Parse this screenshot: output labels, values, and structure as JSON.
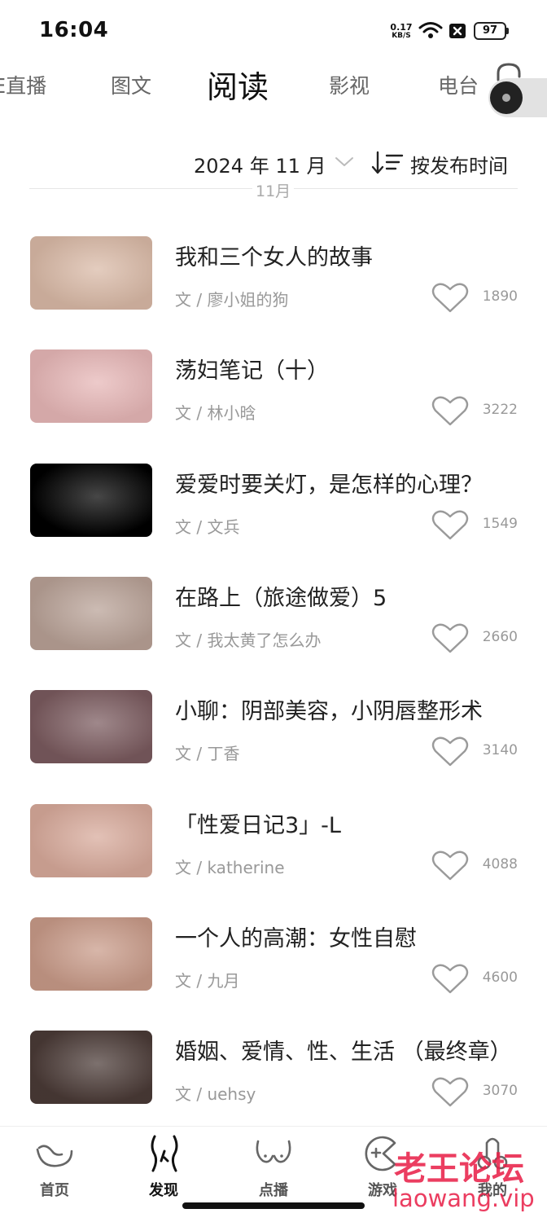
{
  "status_bar": {
    "time": "16:04",
    "net_speed_value": "0.17",
    "net_speed_unit": "KB/S",
    "battery": "97",
    "icons": [
      "wifi-icon",
      "sim-x-icon",
      "battery-icon"
    ]
  },
  "top_tabs": [
    {
      "label": "IE直播",
      "active": false
    },
    {
      "label": "图文",
      "active": false
    },
    {
      "label": "阅读",
      "active": true
    },
    {
      "label": "影视",
      "active": false
    },
    {
      "label": "电台",
      "active": false
    }
  ],
  "filter": {
    "date_label": "2024 年 11 月",
    "sort_label": "按发布时间",
    "month_marker": "11月"
  },
  "articles": [
    {
      "title": "我和三个女人的故事",
      "author": "文 / 廖小姐的狗",
      "likes": "1890",
      "thumb_color": "#d9b9a6"
    },
    {
      "title": "荡妇笔记（十）",
      "author": "文 / 林小晗",
      "likes": "3222",
      "thumb_color": "#e6b6b6"
    },
    {
      "title": "爱爱时要关灯，是怎样的心理？",
      "author": "文 / 文兵",
      "likes": "1549",
      "thumb_color": "#000000"
    },
    {
      "title": "在路上（旅途做爱）5",
      "author": "文 / 我太黄了怎么办",
      "likes": "2660",
      "thumb_color": "#b8a196"
    },
    {
      "title": "小聊：阴部美容，小阴唇整形术",
      "author": "文 / 丁香",
      "likes": "3140",
      "thumb_color": "#7a5a5e"
    },
    {
      "title": "「性爱日记3」-L",
      "author": "文 / katherine",
      "likes": "4088",
      "thumb_color": "#d7a99a"
    },
    {
      "title": "一个人的高潮：女性自慰",
      "author": "文 / 九月",
      "likes": "4600",
      "thumb_color": "#c89a88"
    },
    {
      "title": "婚姻、爱情、性、生活 （最终章）",
      "author": "文 / uehsy",
      "likes": "3070",
      "thumb_color": "#4a3a36"
    }
  ],
  "bottom_nav": [
    {
      "label": "首页",
      "icon": "home-icon",
      "active": false
    },
    {
      "label": "发现",
      "icon": "discover-icon",
      "active": true
    },
    {
      "label": "点播",
      "icon": "vod-icon",
      "active": false
    },
    {
      "label": "游戏",
      "icon": "game-icon",
      "active": false
    },
    {
      "label": "我的",
      "icon": "mine-icon",
      "active": false
    }
  ],
  "watermark": {
    "cn": "老王论坛",
    "en": "laowang.vip"
  },
  "colors": {
    "accent": "#111111",
    "muted": "#999999",
    "watermark": "#e8224a"
  }
}
